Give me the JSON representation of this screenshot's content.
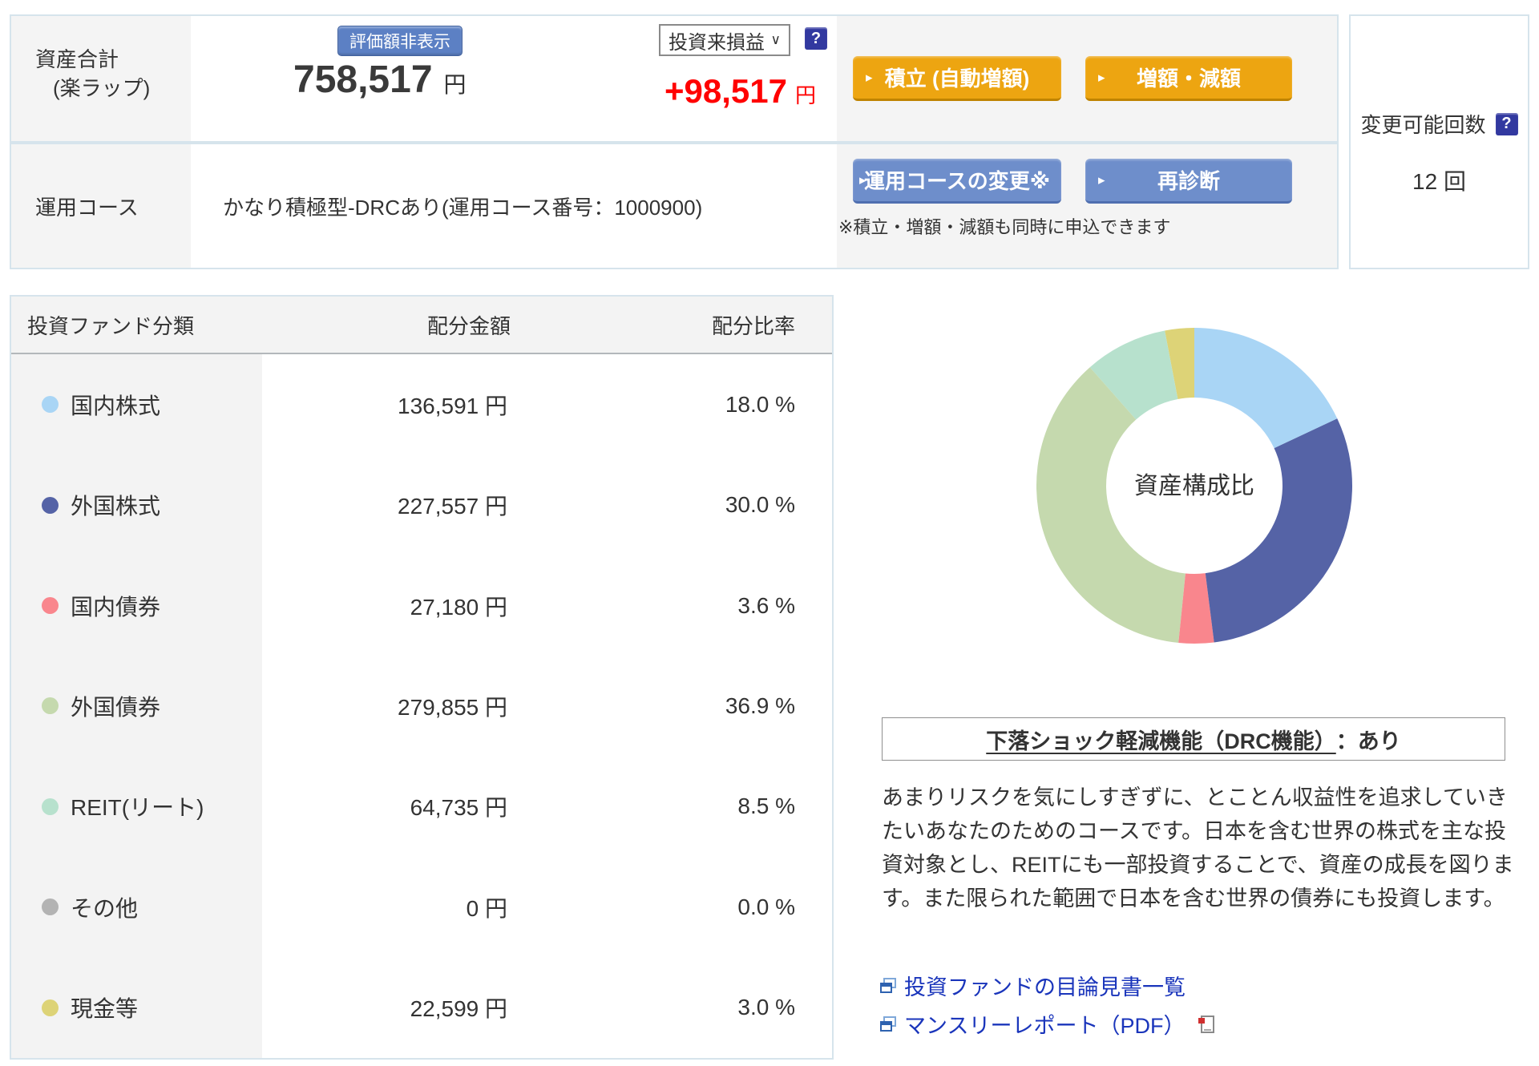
{
  "colors": {
    "accent_orange": "#eda511",
    "accent_blue": "#6e8ecb",
    "hide_btn_blue": "#5c80c4",
    "help_navy": "#3239a0",
    "profit_red": "#ff0000",
    "link_blue": "#1a35bb",
    "border_blue": "#d6e4ec",
    "cell_gray": "#f4f4f4"
  },
  "icons": {
    "arrow": "▸",
    "chevron": "∨",
    "help": "?"
  },
  "summary": {
    "asset_label_line1": "資産合計",
    "asset_label_line2": "(楽ラップ)",
    "hide_value_button": "評価額非表示",
    "total_amount": "758,517",
    "total_unit": "円",
    "pl_select_value": "投資来損益",
    "pl_amount": "+98,517",
    "pl_unit": "円",
    "tsumitate_button": "積立 (自動増額)",
    "zougaku_button": "増額・減額",
    "course_label": "運用コース",
    "course_value": "かなり積極型-DRCあり(運用コース番号：1000900)",
    "course_change_button": "運用コースの変更※",
    "rediagnosis_button": "再診断",
    "note": "※積立・増額・減額も同時に申込できます",
    "change_count_label": "変更可能回数",
    "change_count_value": "12 回"
  },
  "allocation_table": {
    "headers": [
      "投資ファンド分類",
      "配分金額",
      "配分比率"
    ],
    "rows": [
      {
        "label": "国内株式",
        "amount": "136,591 円",
        "ratio": "18.0 %"
      },
      {
        "label": "外国株式",
        "amount": "227,557 円",
        "ratio": "30.0 %"
      },
      {
        "label": "国内債券",
        "amount": "27,180 円",
        "ratio": "3.6 %"
      },
      {
        "label": "外国債券",
        "amount": "279,855 円",
        "ratio": "36.9 %"
      },
      {
        "label": "REIT(リート)",
        "amount": "64,735 円",
        "ratio": "8.5 %"
      },
      {
        "label": "その他",
        "amount": "0 円",
        "ratio": "0.0 %"
      },
      {
        "label": "現金等",
        "amount": "22,599 円",
        "ratio": "3.0 %"
      }
    ]
  },
  "chart_data": {
    "type": "pie",
    "donut": true,
    "title": "資産構成比",
    "center_label": "資産構成比",
    "categories": [
      "国内株式",
      "外国株式",
      "国内債券",
      "外国債券",
      "REIT(リート)",
      "その他",
      "現金等"
    ],
    "values": [
      18.0,
      30.0,
      3.6,
      36.9,
      8.5,
      0.0,
      3.0
    ],
    "colors": [
      "#a9d5f5",
      "#5563a6",
      "#f9868d",
      "#c5d9ae",
      "#b7e1cd",
      "#b3b3b3",
      "#ddd377"
    ],
    "start_angle_deg": 0,
    "direction": "clockwise",
    "legend_position": "none"
  },
  "drc": {
    "link_text": "下落ショック軽減機能（DRC機能）",
    "suffix": "：あり"
  },
  "description": "あまりリスクを気にしすぎずに、とことん収益性を追求していきたいあなたのためのコースです。日本を含む世界の株式を主な投資対象とし、REITにも一部投資することで、資産の成長を図ります。また限られた範囲で日本を含む世界の債券にも投資します。",
  "links": {
    "prospectus": "投資ファンドの目論見書一覧",
    "monthly_report": "マンスリーレポート（PDF）"
  }
}
